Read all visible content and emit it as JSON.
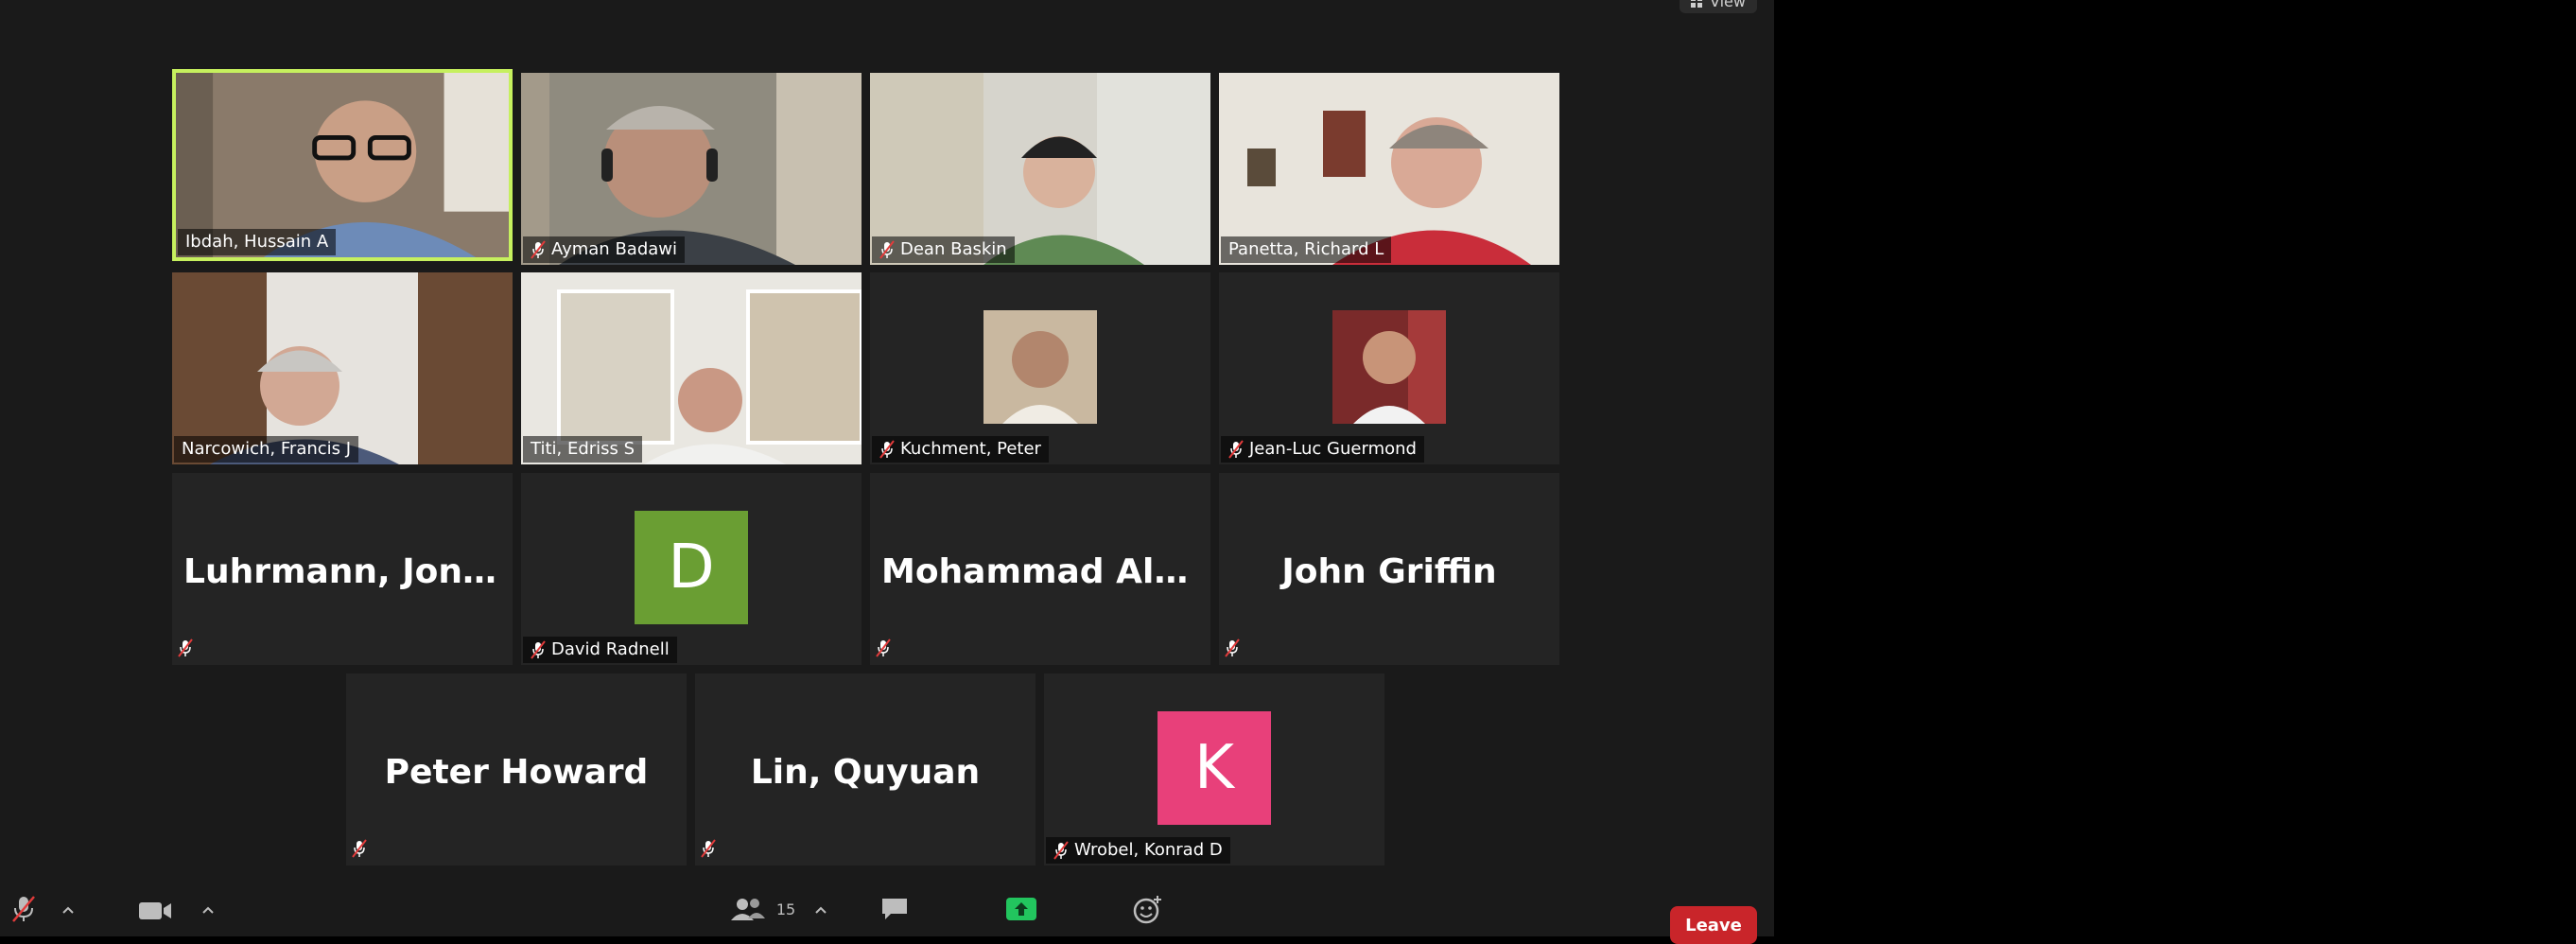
{
  "header": {
    "view_label": "View"
  },
  "participants": [
    {
      "name": "Ibdah, Hussain A",
      "muted": false,
      "type": "video",
      "active": true
    },
    {
      "name": "Ayman Badawi",
      "muted": true,
      "type": "video"
    },
    {
      "name": "Dean Baskin",
      "muted": true,
      "type": "video"
    },
    {
      "name": "Panetta, Richard L",
      "muted": false,
      "type": "video"
    },
    {
      "name": "Narcowich, Francis J",
      "muted": false,
      "type": "video"
    },
    {
      "name": "Titi, Edriss S",
      "muted": false,
      "type": "video"
    },
    {
      "name": "Kuchment, Peter",
      "muted": true,
      "type": "photo"
    },
    {
      "name": "Jean-Luc Guermond",
      "muted": true,
      "type": "photo"
    },
    {
      "name": "Luhrmann, Jonas",
      "muted": true,
      "type": "name-only"
    },
    {
      "name": "David Radnell",
      "muted": true,
      "type": "avatar",
      "initial": "D",
      "avatar_color": "#6a9e33"
    },
    {
      "name": "Mohammad  Al-...",
      "muted": true,
      "type": "name-only"
    },
    {
      "name": "John Griffin",
      "muted": true,
      "type": "name-only"
    },
    {
      "name": "Peter Howard",
      "muted": true,
      "type": "name-only"
    },
    {
      "name": "Lin, Quyuan",
      "muted": true,
      "type": "name-only"
    },
    {
      "name": "Wrobel, Konrad D",
      "muted": true,
      "type": "avatar",
      "initial": "K",
      "avatar_color": "#e8407a"
    }
  ],
  "toolbar": {
    "participants_count": "15",
    "leave_label": "Leave",
    "icons": [
      "microphone-muted-icon",
      "video-camera-icon",
      "participants-icon",
      "chat-icon",
      "share-screen-icon",
      "reactions-icon"
    ],
    "share_color": "#22c55e",
    "leave_color": "#c9252a"
  },
  "colors": {
    "active_speaker_border": "#c6f05e",
    "tile_background": "#242424",
    "app_background": "#1a1a1a"
  }
}
